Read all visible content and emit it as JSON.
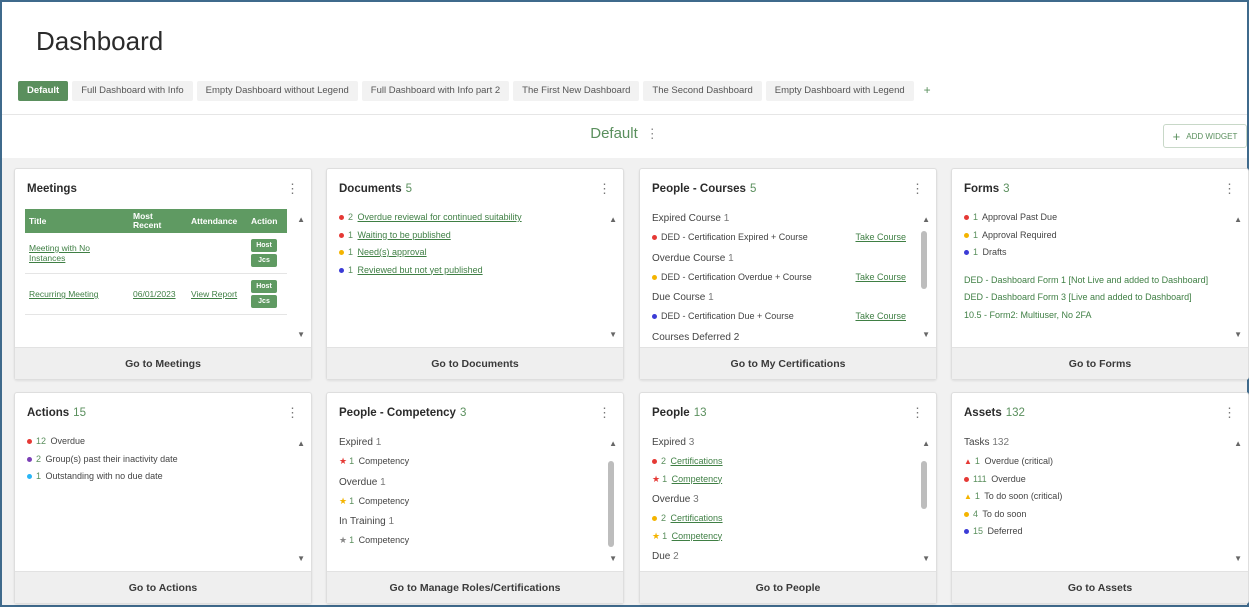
{
  "page": {
    "title": "Dashboard"
  },
  "tabs": [
    {
      "label": "Default",
      "active": true
    },
    {
      "label": "Full Dashboard with Info"
    },
    {
      "label": "Empty Dashboard without Legend"
    },
    {
      "label": "Full Dashboard with Info part 2"
    },
    {
      "label": "The First New Dashboard"
    },
    {
      "label": "The Second Dashboard"
    },
    {
      "label": "Empty Dashboard with Legend"
    },
    {
      "label": "+"
    }
  ],
  "header": {
    "dashboard_name": "Default",
    "kebab": "⋮",
    "add_widget": "ADD WIDGET",
    "add_icon": "+"
  },
  "colors": {
    "accent": "#5a8f5d",
    "red": "#e53935",
    "yellow": "#f4b400",
    "blue": "#3b3bd6"
  },
  "meetings": {
    "title": "Meetings",
    "columns": [
      "Title",
      "Most Recent",
      "Attendance",
      "Action"
    ],
    "rows": [
      {
        "title": "Meeting with No Instances",
        "recent": "",
        "attendance": "",
        "actions": [
          "Host",
          "Jcs"
        ]
      },
      {
        "title": "Recurring Meeting",
        "recent": "06/01/2023",
        "attendance": "View Report",
        "actions": [
          "Host",
          "Jcs"
        ]
      }
    ],
    "footer": "Go to Meetings"
  },
  "documents": {
    "title": "Documents",
    "count": "5",
    "items": [
      {
        "num": "2",
        "text": "Overdue reviewal for continued suitability",
        "color": "red"
      },
      {
        "num": "1",
        "text": "Waiting to be published",
        "color": "red"
      },
      {
        "num": "1",
        "text": "Need(s) approval",
        "color": "yellow"
      },
      {
        "num": "1",
        "text": "Reviewed but not yet published",
        "color": "blue"
      }
    ],
    "footer": "Go to Documents"
  },
  "courses": {
    "title": "People - Courses",
    "count": "5",
    "groups": [
      {
        "label": "Expired Course",
        "count": "1",
        "item": "DED - Certification Expired + Course",
        "action": "Take Course",
        "color": "red"
      },
      {
        "label": "Overdue Course",
        "count": "1",
        "item": "DED - Certification Overdue + Course",
        "action": "Take Course",
        "color": "yellow"
      },
      {
        "label": "Due Course",
        "count": "1",
        "item": "DED - Certification Due + Course",
        "action": "Take Course",
        "color": "blue"
      }
    ],
    "trailing": "Courses Deferred 2",
    "footer": "Go to My Certifications"
  },
  "forms": {
    "title": "Forms",
    "count": "3",
    "items": [
      {
        "num": "1",
        "text": "Approval Past Due",
        "color": "red"
      },
      {
        "num": "1",
        "text": "Approval Required",
        "color": "yellow"
      },
      {
        "num": "1",
        "text": "Drafts",
        "color": "blue"
      }
    ],
    "links": [
      "DED - Dashboard Form 1 [Not Live and added to Dashboard]",
      "DED - Dashboard Form 3 [Live and added to Dashboard]",
      "10.5 - Form2: Multiuser, No 2FA"
    ],
    "footer": "Go to Forms"
  },
  "actions": {
    "title": "Actions",
    "count": "15",
    "items": [
      {
        "num": "12",
        "text": "Overdue",
        "color": "red"
      },
      {
        "num": "2",
        "text": "Group(s) past their inactivity date",
        "color": "purple"
      },
      {
        "num": "1",
        "text": "Outstanding with no due date",
        "color": "cyan"
      }
    ],
    "footer": "Go to Actions"
  },
  "competency": {
    "title": "People - Competency",
    "count": "3",
    "groups": [
      {
        "label": "Expired",
        "count": "1",
        "num": "1",
        "item": "Competency",
        "star": "red"
      },
      {
        "label": "Overdue",
        "count": "1",
        "num": "1",
        "item": "Competency",
        "star": "yellow"
      },
      {
        "label": "In Training",
        "count": "1",
        "num": "1",
        "item": "Competency",
        "star": "grey"
      }
    ],
    "footer": "Go to Manage Roles/Certifications"
  },
  "people": {
    "title": "People",
    "count": "13",
    "groups": [
      {
        "label": "Expired",
        "count": "3",
        "items": [
          {
            "num": "2",
            "text": "Certifications",
            "mark": "dot-red"
          },
          {
            "num": "1",
            "text": "Competency",
            "mark": "star-red"
          }
        ]
      },
      {
        "label": "Overdue",
        "count": "3",
        "items": [
          {
            "num": "2",
            "text": "Certifications",
            "mark": "dot-yellow"
          },
          {
            "num": "1",
            "text": "Competency",
            "mark": "star-yellow"
          }
        ]
      }
    ],
    "trailing_label": "Due",
    "trailing_count": "2",
    "footer": "Go to People"
  },
  "assets": {
    "title": "Assets",
    "count": "132",
    "sub_label": "Tasks",
    "sub_count": "132",
    "items": [
      {
        "num": "1",
        "text": "Overdue (critical)",
        "mark": "tri-red"
      },
      {
        "num": "111",
        "text": "Overdue",
        "mark": "dot-red"
      },
      {
        "num": "1",
        "text": "To do soon (critical)",
        "mark": "tri-yellow"
      },
      {
        "num": "4",
        "text": "To do soon",
        "mark": "dot-yellow"
      },
      {
        "num": "15",
        "text": "Deferred",
        "mark": "dot-blue"
      }
    ],
    "footer": "Go to Assets"
  }
}
